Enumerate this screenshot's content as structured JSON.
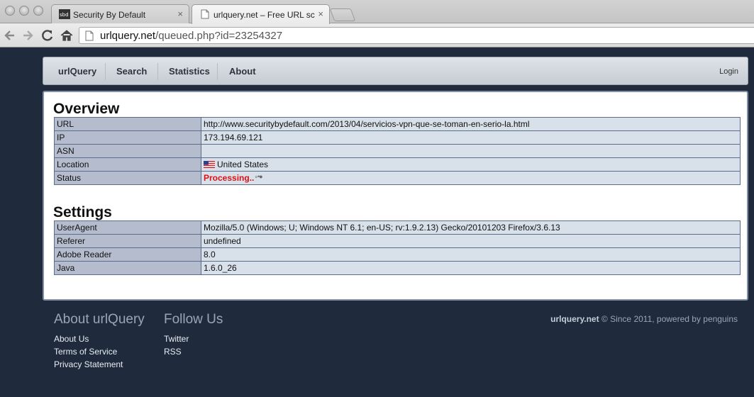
{
  "browser": {
    "tabs": [
      {
        "title": "Security By Default",
        "active": false
      },
      {
        "title": "urlquery.net – Free URL sc",
        "active": true
      }
    ],
    "address": {
      "host": "urlquery.net",
      "path": "/queued.php?id=23254327"
    }
  },
  "nav": {
    "items": [
      "urlQuery",
      "Search",
      "Statistics",
      "About"
    ],
    "login": "Login"
  },
  "overview": {
    "title": "Overview",
    "rows": [
      {
        "key": "URL",
        "value": "http://www.securitybydefault.com/2013/04/servicios-vpn-que-se-toman-en-serio-la.html"
      },
      {
        "key": "IP",
        "value": "173.194.69.121"
      },
      {
        "key": "ASN",
        "value": ""
      },
      {
        "key": "Location",
        "value": "United States"
      },
      {
        "key": "Status",
        "value": "Processing.."
      }
    ]
  },
  "settings": {
    "title": "Settings",
    "rows": [
      {
        "key": "UserAgent",
        "value": "Mozilla/5.0 (Windows; U; Windows NT 6.1; en-US; rv:1.9.2.13) Gecko/20101203 Firefox/3.6.13"
      },
      {
        "key": "Referer",
        "value": "undefined"
      },
      {
        "key": "Adobe Reader",
        "value": "8.0"
      },
      {
        "key": "Java",
        "value": "1.6.0_26"
      }
    ]
  },
  "footer": {
    "about_heading": "About urlQuery",
    "about_links": [
      "About Us",
      "Terms of Service",
      "Privacy Statement"
    ],
    "follow_heading": "Follow Us",
    "follow_links": [
      "Twitter",
      "RSS"
    ],
    "brand": "urlquery.net",
    "copyright": " © Since 2011, powered by penguins"
  },
  "icons": {
    "tab_favicon_1": "sbd-favicon-icon",
    "tab_favicon_2": "document-icon",
    "location_flag": "us-flag-icon",
    "status_spinner": "loading-spinner-icon"
  },
  "colors": {
    "page_background": "#1f2b3d",
    "status_processing": "#e01010",
    "table_key_background": "#b4bccd",
    "table_value_background": "#d8e0ea"
  }
}
